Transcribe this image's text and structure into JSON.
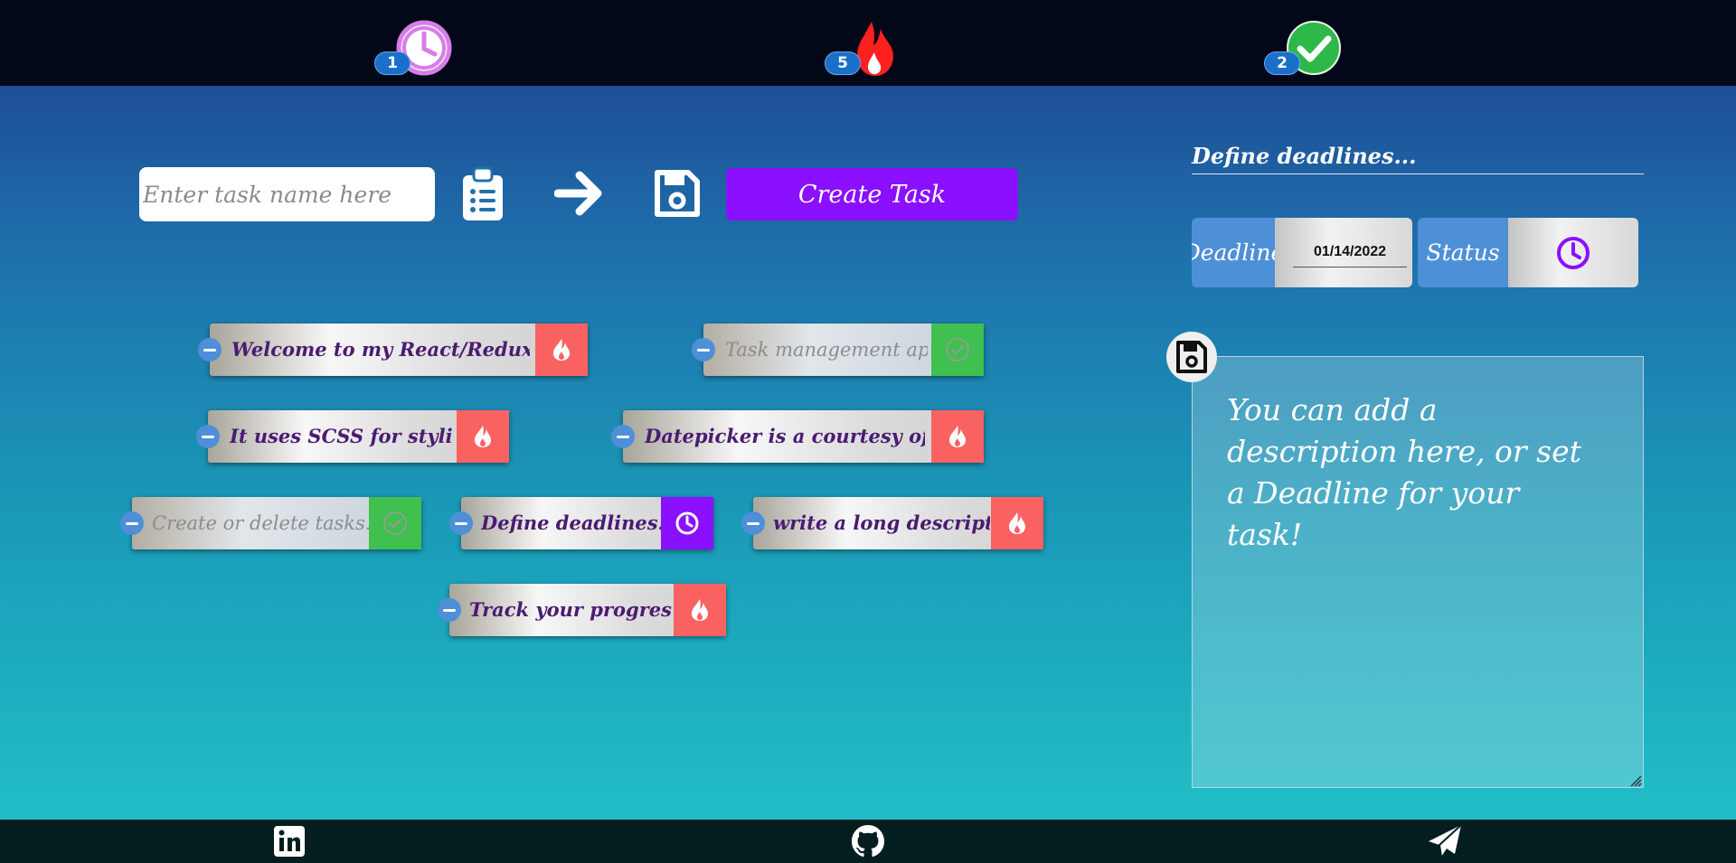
{
  "header": {
    "counters": [
      {
        "name": "pending",
        "icon": "clock-icon",
        "count": "1",
        "color": "#d77de8"
      },
      {
        "name": "urgent",
        "icon": "fire-icon",
        "count": "5",
        "color": "#ff2020"
      },
      {
        "name": "done",
        "icon": "check-circle-icon",
        "count": "2",
        "color": "#2fb84a"
      }
    ]
  },
  "composer": {
    "input_placeholder": "Enter task name here",
    "input_value": "",
    "create_label": "Create Task",
    "icons": [
      "clipboard-list-icon",
      "arrow-right-icon",
      "save-icon"
    ]
  },
  "tasks": [
    {
      "text": "Welcome to my React/Redux based",
      "status": "urgent",
      "status_icon": "fire-icon"
    },
    {
      "text": "Task management app",
      "status": "done",
      "status_icon": "check-circle-icon"
    },
    {
      "text": "It uses SCSS for styling",
      "status": "urgent",
      "status_icon": "fire-icon"
    },
    {
      "text": "Datepicker is a courtesy of MUI",
      "status": "urgent",
      "status_icon": "fire-icon"
    },
    {
      "text": "Create or delete tasks...",
      "status": "done",
      "status_icon": "check-circle-icon"
    },
    {
      "text": "Define deadlines...",
      "status": "pending",
      "status_icon": "clock-icon"
    },
    {
      "text": "write a long description",
      "status": "urgent",
      "status_icon": "fire-icon"
    },
    {
      "text": "Track your progress :)",
      "status": "urgent",
      "status_icon": "fire-icon"
    }
  ],
  "details": {
    "selected_title": "Define deadlines...",
    "deadline_label": "Deadline",
    "deadline_value": "01/14/2022",
    "status_label": "Status",
    "status_icon": "clock-icon",
    "description": "You can add a description here, or set a Deadline for your task!",
    "save_icon": "save-icon"
  },
  "footer": {
    "icons": [
      "linkedin-icon",
      "github-icon",
      "paper-plane-icon"
    ]
  },
  "colors": {
    "urgent": "#fa6262",
    "done": "#3fc04f",
    "pending": "#8a10ff",
    "accent": "#8a10ff",
    "chip_text": "#4b1b72"
  }
}
